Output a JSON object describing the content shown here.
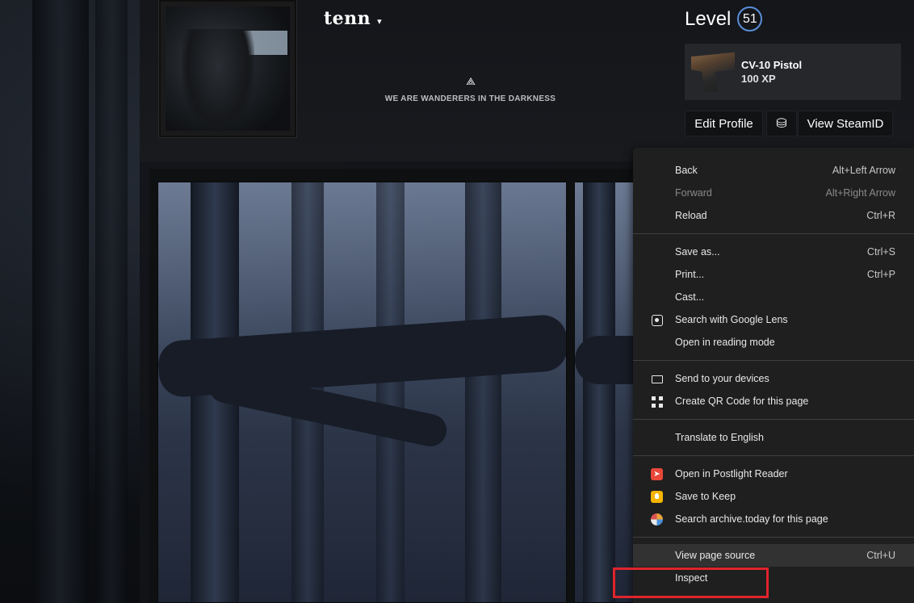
{
  "profile": {
    "persona_name": "tenn",
    "persona_arrow": "▾",
    "summary_logo": "⟁",
    "summary_text": "WE ARE WANDERERS IN THE DARKNESS"
  },
  "level": {
    "label": "Level",
    "value": "51",
    "badge_color": "#5b8ed8"
  },
  "featured_badge": {
    "name": "CV-10 Pistol",
    "xp": "100 XP"
  },
  "buttons": {
    "edit_profile": "Edit Profile",
    "coin_icon": "⛁",
    "view_steamid": "View SteamID"
  },
  "context_menu": {
    "groups": [
      [
        {
          "label": "Back",
          "shortcut": "Alt+Left Arrow",
          "disabled": false
        },
        {
          "label": "Forward",
          "shortcut": "Alt+Right Arrow",
          "disabled": true
        },
        {
          "label": "Reload",
          "shortcut": "Ctrl+R",
          "disabled": false
        }
      ],
      [
        {
          "label": "Save as...",
          "shortcut": "Ctrl+S"
        },
        {
          "label": "Print...",
          "shortcut": "Ctrl+P"
        },
        {
          "label": "Cast...",
          "shortcut": ""
        },
        {
          "label": "Search with Google Lens",
          "shortcut": "",
          "icon": "google-lens-icon"
        },
        {
          "label": "Open in reading mode",
          "shortcut": ""
        }
      ],
      [
        {
          "label": "Send to your devices",
          "shortcut": "",
          "icon": "devices-icon"
        },
        {
          "label": "Create QR Code for this page",
          "shortcut": "",
          "icon": "qr-code-icon"
        }
      ],
      [
        {
          "label": "Translate to English",
          "shortcut": ""
        }
      ],
      [
        {
          "label": "Open in Postlight Reader",
          "shortcut": "",
          "icon": "postlight-reader-icon"
        },
        {
          "label": "Save to Keep",
          "shortcut": "",
          "icon": "keep-icon"
        },
        {
          "label": "Search archive.today for this page",
          "shortcut": "",
          "icon": "archive-today-icon"
        }
      ],
      [
        {
          "label": "View page source",
          "shortcut": "Ctrl+U",
          "hover": true
        },
        {
          "label": "Inspect",
          "shortcut": ""
        }
      ]
    ],
    "highlight_color": "#e0242c"
  }
}
